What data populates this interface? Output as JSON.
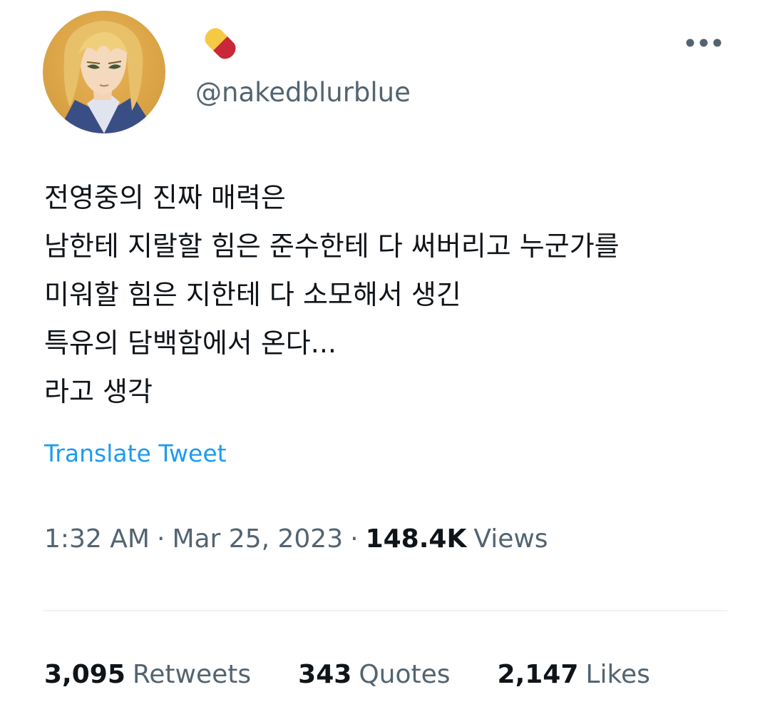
{
  "author": {
    "avatar_icon": "profile-avatar",
    "display_name_icon": "pill-emoji",
    "handle": "@nakedblurblue"
  },
  "menu": {
    "more_icon": "more-horizontal-icon"
  },
  "tweet": {
    "lines": [
      "전영중의 진짜 매력은",
      "남한테 지랄할 힘은 준수한테 다 써버리고 누군가를",
      "미워할 힘은 지한테 다 소모해서 생긴",
      "특유의 담백함에서 온다...",
      "라고 생각"
    ],
    "translate_label": "Translate Tweet"
  },
  "meta": {
    "time": "1:32 AM",
    "separator": "·",
    "date": "Mar 25, 2023",
    "views_count": "148.4K",
    "views_label": "Views"
  },
  "stats": {
    "retweets_count": "3,095",
    "retweets_label": "Retweets",
    "quotes_count": "343",
    "quotes_label": "Quotes",
    "likes_count": "2,147",
    "likes_label": "Likes"
  },
  "colors": {
    "link": "#1d9bf0",
    "secondary_text": "#536471",
    "primary_text": "#0f1419",
    "pill_yellow": "#f6c945",
    "pill_red": "#c8283a"
  }
}
